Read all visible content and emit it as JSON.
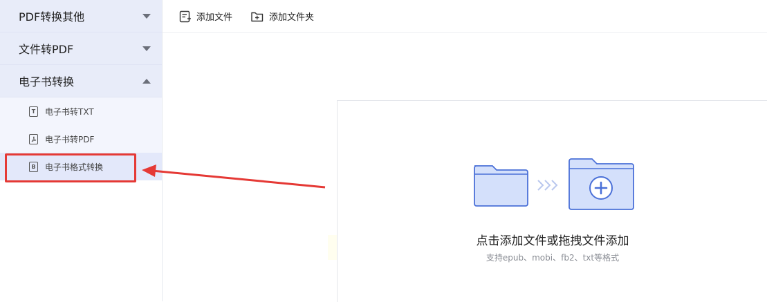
{
  "sidebar": {
    "categories": [
      {
        "label": "PDF转换其他",
        "expanded": false
      },
      {
        "label": "文件转PDF",
        "expanded": false
      },
      {
        "label": "电子书转换",
        "expanded": true
      }
    ],
    "sub_items": [
      {
        "label": "电子书转TXT",
        "icon": "txt-file-icon",
        "icon_letter": "T"
      },
      {
        "label": "电子书转PDF",
        "icon": "pdf-file-icon",
        "icon_letter": "⟆"
      },
      {
        "label": "电子书格式转换",
        "icon": "ebook-file-icon",
        "icon_letter": "B",
        "active": true
      }
    ]
  },
  "toolbar": {
    "add_file_label": "添加文件",
    "add_folder_label": "添加文件夹"
  },
  "dropzone": {
    "title": "点击添加文件或拖拽文件添加",
    "subtitle": "支持epub、mobi、fb2、txt等格式"
  },
  "colors": {
    "accent": "#3a66d6",
    "folder_fill": "#d4e0fb",
    "folder_stroke": "#4a70d8",
    "sidebar_category_bg": "#e8ecf9",
    "annotation_red": "#e53935"
  }
}
